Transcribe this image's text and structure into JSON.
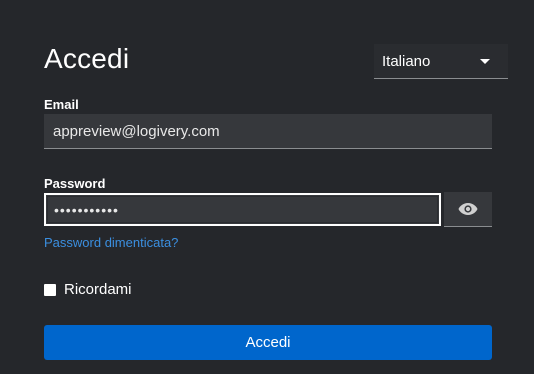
{
  "login": {
    "title": "Accedi",
    "language": {
      "selected": "Italiano",
      "icon": "chevron-down-icon"
    },
    "email": {
      "label": "Email",
      "value": "appreview@logivery.com"
    },
    "password": {
      "label": "Password",
      "value": "•••••••••••",
      "toggle_icon": "eye-icon"
    },
    "forgot_password": "Password dimenticata?",
    "remember_me": {
      "label": "Ricordami",
      "checked": false
    },
    "submit_label": "Accedi"
  },
  "colors": {
    "background": "#25272b",
    "input_background": "#36383c",
    "link": "#3b8fe0",
    "primary_button": "#0066cc"
  }
}
